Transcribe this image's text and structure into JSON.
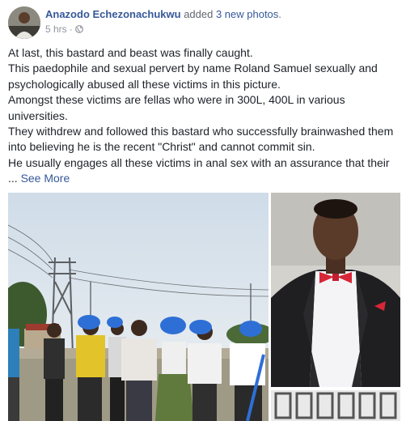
{
  "post": {
    "author_name": "Anazodo Echezonachukwu",
    "action_text": " added ",
    "action_link": "3 new photos",
    "action_end": ".",
    "timestamp": "5 hrs",
    "privacy_icon": "globe-icon",
    "paragraphs": [
      "At last, this bastard and beast was finally caught.",
      "This paedophile and sexual pervert by name Roland Samuel sexually and psychologically abused all these victims in this picture.",
      "Amongst these victims are fellas who were in 300L, 400L in various universities.",
      "They withdrew and followed this bastard who successfully brainwashed them into believing he is the recent \"Christ\" and cannot commit sin.",
      "He usually engages all these victims in anal sex with an assurance that their"
    ],
    "ellipsis": "... ",
    "see_more": "See More"
  },
  "colors": {
    "link": "#365899",
    "text": "#1d2129",
    "meta": "#90949c"
  }
}
